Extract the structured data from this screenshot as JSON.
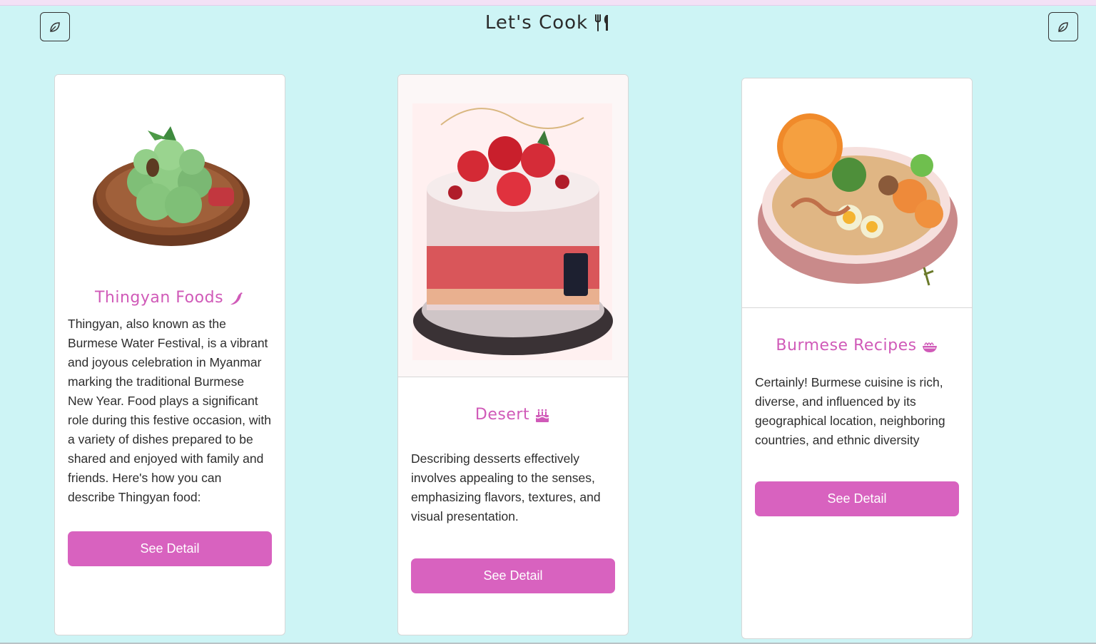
{
  "header": {
    "title": "Let's Cook",
    "title_icon": "fork-knife-icon",
    "left_button_icon": "leaf-icon",
    "right_button_icon": "leaf-icon"
  },
  "cards": [
    {
      "title": "Thingyan Foods",
      "title_icon": "chili-pepper-icon",
      "image": "green-rice-balls-on-plate",
      "text": "Thingyan, also known as the Burmese Water Festival, is a vibrant and joyous celebration in Myanmar marking the traditional Burmese New Year. Food plays a significant role during this festive occasion, with a variety of dishes prepared to be shared and enjoyed with family and friends. Here's how you can describe Thingyan food:",
      "button": "See Detail"
    },
    {
      "title": "Desert",
      "title_icon": "birthday-cake-icon",
      "image": "strawberry-cake",
      "text": "Describing desserts effectively involves appealing to the senses, emphasizing flavors, textures, and visual presentation.",
      "button": "See Detail"
    },
    {
      "title": "Burmese Recipes",
      "title_icon": "noodle-bowl-icon",
      "image": "burmese-noodle-bowl",
      "text": "Certainly! Burmese cuisine is rich, diverse, and influenced by its geographical location, neighboring countries, and ethnic diversity",
      "button": "See Detail"
    }
  ],
  "colors": {
    "background": "#cdf4f5",
    "accent": "#d862bf",
    "title_pink": "#d05ab8"
  }
}
